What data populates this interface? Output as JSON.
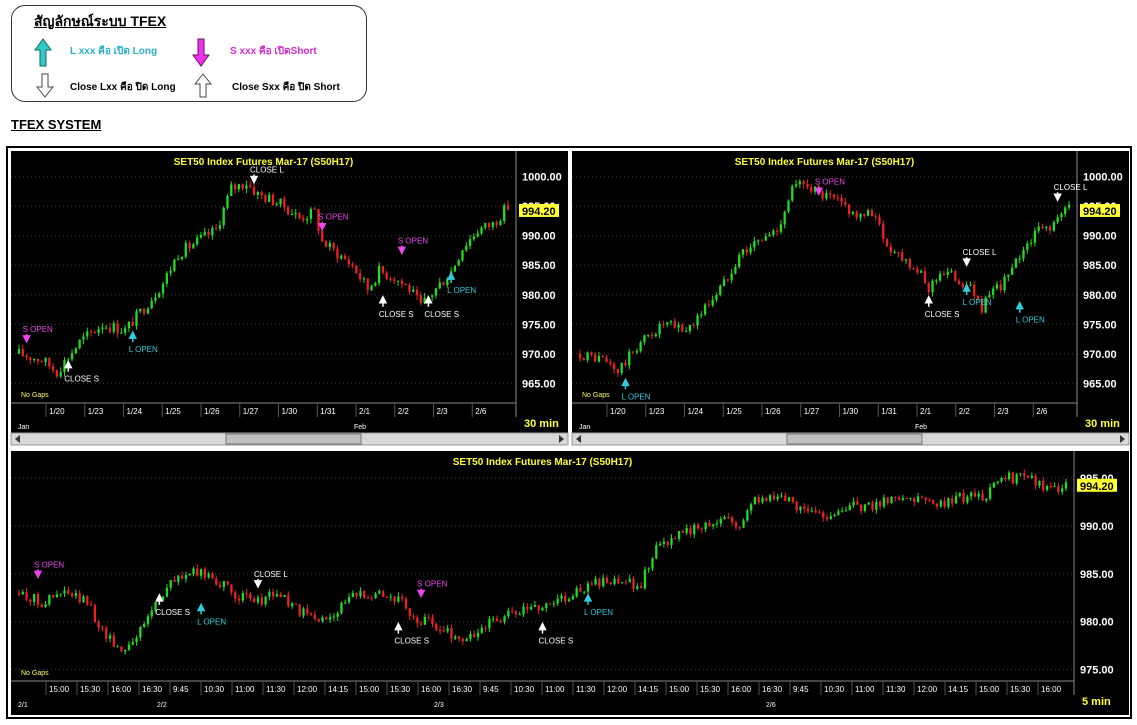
{
  "legend": {
    "title": "สัญลักษณ์ระบบ TFEX",
    "long_open": "L xxx คือ เปิด Long",
    "short_open": "S xxx คือ เปิดShort",
    "close_long": "Close Lxx คือ ปิด Long",
    "close_short": "Close Sxx คือ ปิด Short",
    "icons": [
      "arrow-up-cyan-icon",
      "arrow-down-magenta-icon",
      "arrow-down-outline-icon",
      "arrow-up-outline-icon"
    ]
  },
  "system_title": "TFEX SYSTEM",
  "colors": {
    "up": "#22dd22",
    "down": "#ee2222",
    "title": "#ffff33",
    "long": "#33ccdd",
    "short": "#ee44ee",
    "close": "#ffffff",
    "last_price_bg": "#ffff33"
  },
  "chart_data": [
    {
      "type": "candlestick",
      "title": "SET50  Index  Futures  Mar-17   (S50H17)",
      "timeframe": "30  min",
      "gaps_label": "No  Gaps",
      "last_price": "994.20",
      "ylim": [
        962,
        1003
      ],
      "y_ticks": [
        "1000.00",
        "995.00",
        "990.00",
        "985.00",
        "980.00",
        "975.00",
        "970.00",
        "965.00"
      ],
      "x_ticks": [
        "1/20",
        "1/23",
        "1/24",
        "1/25",
        "1/26",
        "1/27",
        "1/30",
        "1/31",
        "2/1",
        "2/2",
        "2/3",
        "2/6"
      ],
      "month_labels": [
        "Jan",
        "Feb"
      ],
      "path": [
        [
          0,
          970
        ],
        [
          6,
          969
        ],
        [
          10,
          967
        ],
        [
          16,
          972
        ],
        [
          22,
          975
        ],
        [
          28,
          974
        ],
        [
          32,
          977
        ],
        [
          38,
          982
        ],
        [
          42,
          987
        ],
        [
          47,
          989
        ],
        [
          52,
          991
        ],
        [
          56,
          998
        ],
        [
          60,
          999
        ],
        [
          63,
          997
        ],
        [
          67,
          996
        ],
        [
          70,
          995
        ],
        [
          74,
          993
        ],
        [
          78,
          994
        ],
        [
          80,
          989
        ],
        [
          84,
          987
        ],
        [
          88,
          985
        ],
        [
          92,
          981
        ],
        [
          95,
          984
        ],
        [
          99,
          983
        ],
        [
          103,
          981
        ],
        [
          106,
          978
        ],
        [
          110,
          981
        ],
        [
          114,
          984
        ],
        [
          117,
          988
        ],
        [
          121,
          991
        ],
        [
          125,
          992
        ],
        [
          129,
          995
        ]
      ],
      "signals": [
        {
          "label": "S  OPEN",
          "kind": "short",
          "at": 2,
          "price": 971
        },
        {
          "label": "CLOSE  S",
          "kind": "close_short",
          "at": 13,
          "price": 969
        },
        {
          "label": "L  OPEN",
          "kind": "long",
          "at": 30,
          "price": 974
        },
        {
          "label": "CLOSE  L",
          "kind": "close_long",
          "at": 62,
          "price": 998
        },
        {
          "label": "S  OPEN",
          "kind": "short",
          "at": 80,
          "price": 990
        },
        {
          "label": "S  OPEN",
          "kind": "short",
          "at": 101,
          "price": 986
        },
        {
          "label": "CLOSE  S",
          "kind": "close_short",
          "at": 96,
          "price": 980
        },
        {
          "label": "L  OPEN",
          "kind": "long",
          "at": 114,
          "price": 984
        },
        {
          "label": "CLOSE  S",
          "kind": "close_short",
          "at": 108,
          "price": 980
        }
      ]
    },
    {
      "type": "candlestick",
      "title": "SET50  Index  Futures  Mar-17   (S50H17)",
      "timeframe": "30  min",
      "gaps_label": "No  Gaps",
      "last_price": "994.20",
      "ylim": [
        962,
        1003
      ],
      "y_ticks": [
        "1000.00",
        "995.00",
        "990.00",
        "985.00",
        "980.00",
        "975.00",
        "970.00",
        "965.00"
      ],
      "x_ticks": [
        "1/20",
        "1/23",
        "1/24",
        "1/25",
        "1/26",
        "1/27",
        "1/30",
        "1/31",
        "2/1",
        "2/2",
        "2/3",
        "2/6"
      ],
      "month_labels": [
        "Jan",
        "Feb"
      ],
      "path": [
        [
          0,
          970
        ],
        [
          6,
          969
        ],
        [
          10,
          967
        ],
        [
          16,
          972
        ],
        [
          22,
          975
        ],
        [
          28,
          974
        ],
        [
          32,
          977
        ],
        [
          38,
          982
        ],
        [
          42,
          987
        ],
        [
          47,
          989
        ],
        [
          52,
          991
        ],
        [
          56,
          998
        ],
        [
          60,
          999
        ],
        [
          63,
          997
        ],
        [
          67,
          996
        ],
        [
          70,
          995
        ],
        [
          74,
          993
        ],
        [
          78,
          994
        ],
        [
          80,
          989
        ],
        [
          84,
          987
        ],
        [
          88,
          985
        ],
        [
          92,
          981
        ],
        [
          95,
          984
        ],
        [
          99,
          983
        ],
        [
          103,
          981
        ],
        [
          106,
          978
        ],
        [
          110,
          981
        ],
        [
          114,
          984
        ],
        [
          117,
          988
        ],
        [
          121,
          991
        ],
        [
          125,
          992
        ],
        [
          129,
          995
        ]
      ],
      "signals": [
        {
          "label": "L  OPEN",
          "kind": "long",
          "at": 12,
          "price": 966
        },
        {
          "label": "S  OPEN",
          "kind": "short",
          "at": 63,
          "price": 996
        },
        {
          "label": "CLOSE  S",
          "kind": "close_short",
          "at": 92,
          "price": 980
        },
        {
          "label": "L  OPEN",
          "kind": "long",
          "at": 102,
          "price": 982
        },
        {
          "label": "CLOSE  L",
          "kind": "close_long",
          "at": 102,
          "price": 984
        },
        {
          "label": "L  OPEN",
          "kind": "long",
          "at": 116,
          "price": 979
        },
        {
          "label": "CLOSE  L",
          "kind": "close_long",
          "at": 126,
          "price": 995
        }
      ]
    },
    {
      "type": "candlestick",
      "title": "SET50  Index  Futures  Mar-17   (S50H17)",
      "timeframe": "5  min",
      "gaps_label": "No  Gaps",
      "last_price": "994.20",
      "ylim": [
        974,
        997
      ],
      "y_ticks": [
        "995.00",
        "990.00",
        "985.00",
        "980.00",
        "975.00"
      ],
      "x_ticks": [
        "15:00",
        "15:30",
        "16:00",
        "16:30",
        "9:45",
        "10:30",
        "11:00",
        "11:30",
        "12:00",
        "14:15",
        "15:00",
        "15:30",
        "16:00",
        "16:30",
        "9:45",
        "10:30",
        "11:00",
        "11:30",
        "12:00",
        "14:15",
        "15:00",
        "15:30",
        "16:00",
        "16:30",
        "9:45",
        "10:30",
        "11:00",
        "11:30",
        "12:00",
        "14:15",
        "15:00",
        "15:30",
        "16:00"
      ],
      "month_labels": [
        "2/1",
        "2/2",
        "2/3",
        "2/6"
      ],
      "path": [
        [
          0,
          983
        ],
        [
          6,
          982
        ],
        [
          12,
          983
        ],
        [
          18,
          982
        ],
        [
          22,
          979
        ],
        [
          27,
          977
        ],
        [
          32,
          979
        ],
        [
          36,
          982
        ],
        [
          40,
          984
        ],
        [
          44,
          985
        ],
        [
          50,
          985
        ],
        [
          56,
          983
        ],
        [
          62,
          982
        ],
        [
          68,
          983
        ],
        [
          74,
          981
        ],
        [
          80,
          980
        ],
        [
          86,
          982
        ],
        [
          90,
          983
        ],
        [
          96,
          983
        ],
        [
          101,
          982
        ],
        [
          104,
          980
        ],
        [
          108,
          980
        ],
        [
          112,
          979
        ],
        [
          118,
          978
        ],
        [
          124,
          980
        ],
        [
          132,
          981
        ],
        [
          140,
          982
        ],
        [
          146,
          983
        ],
        [
          152,
          984
        ],
        [
          158,
          984
        ],
        [
          164,
          984
        ],
        [
          168,
          988
        ],
        [
          174,
          989
        ],
        [
          180,
          990
        ],
        [
          186,
          991
        ],
        [
          190,
          990
        ],
        [
          194,
          993
        ],
        [
          200,
          993
        ],
        [
          206,
          992
        ],
        [
          212,
          991
        ],
        [
          218,
          992
        ],
        [
          224,
          992
        ],
        [
          230,
          993
        ],
        [
          236,
          993
        ],
        [
          242,
          992
        ],
        [
          248,
          993
        ],
        [
          254,
          993
        ],
        [
          260,
          995
        ],
        [
          266,
          995
        ],
        [
          272,
          994
        ],
        [
          276,
          994
        ]
      ],
      "signals": [
        {
          "label": "S  OPEN",
          "kind": "short",
          "at": 5,
          "price": 984
        },
        {
          "label": "CLOSE  S",
          "kind": "close_short",
          "at": 37,
          "price": 983
        },
        {
          "label": "L  OPEN",
          "kind": "long",
          "at": 48,
          "price": 982
        },
        {
          "label": "CLOSE  L",
          "kind": "close_long",
          "at": 63,
          "price": 983
        },
        {
          "label": "S  OPEN",
          "kind": "short",
          "at": 106,
          "price": 982
        },
        {
          "label": "CLOSE  S",
          "kind": "close_short",
          "at": 100,
          "price": 980
        },
        {
          "label": "CLOSE  S",
          "kind": "close_short",
          "at": 138,
          "price": 980
        },
        {
          "label": "L  OPEN",
          "kind": "long",
          "at": 150,
          "price": 983
        }
      ]
    }
  ]
}
